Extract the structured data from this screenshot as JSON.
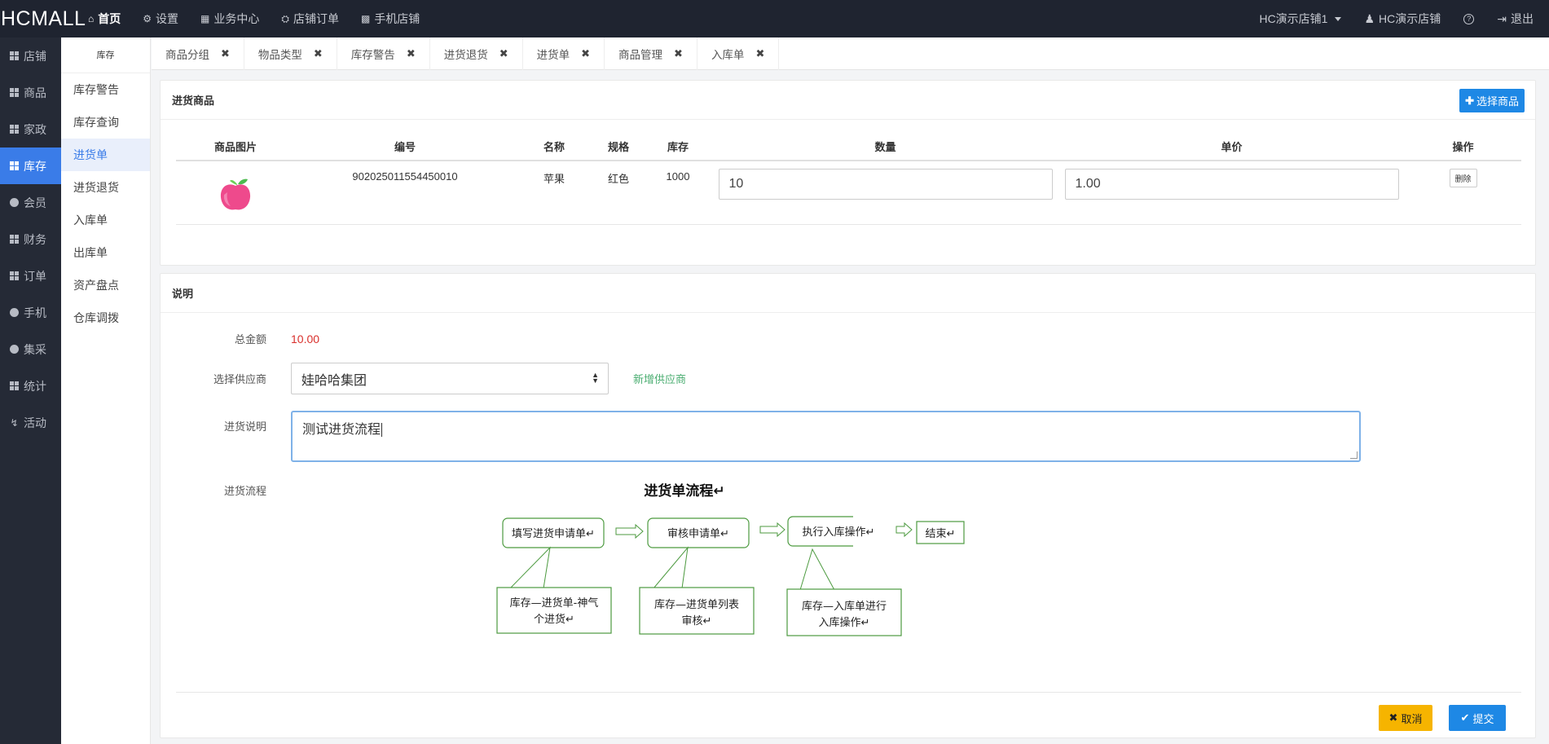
{
  "topbar": {
    "brand": "HCMALL",
    "nav": [
      {
        "label": "首页",
        "icon": "home-icon",
        "active": true
      },
      {
        "label": "设置",
        "icon": "gear-icon"
      },
      {
        "label": "业务中心",
        "icon": "calculator-icon"
      },
      {
        "label": "店铺订单",
        "icon": "cart-icon"
      },
      {
        "label": "手机店铺",
        "icon": "qrcode-icon"
      }
    ],
    "store_select": "HC演示店铺1",
    "user": "HC演示店铺",
    "help_icon": "question-icon",
    "logout": "退出"
  },
  "sidebar": {
    "items": [
      {
        "label": "店铺",
        "icon": "grid-icon"
      },
      {
        "label": "商品",
        "icon": "grid-icon"
      },
      {
        "label": "家政",
        "icon": "grid-icon"
      },
      {
        "label": "库存",
        "icon": "grid-icon",
        "active": true
      },
      {
        "label": "会员",
        "icon": "globe-icon"
      },
      {
        "label": "财务",
        "icon": "grid-icon"
      },
      {
        "label": "订单",
        "icon": "grid-icon"
      },
      {
        "label": "手机",
        "icon": "globe-icon"
      },
      {
        "label": "集采",
        "icon": "globe-icon"
      },
      {
        "label": "统计",
        "icon": "grid-icon"
      },
      {
        "label": "活动",
        "icon": "bolt-icon"
      }
    ]
  },
  "submenu": {
    "title": "库存",
    "items": [
      "库存警告",
      "库存查询",
      "进货单",
      "进货退货",
      "入库单",
      "出库单",
      "资产盘点",
      "仓库调拨"
    ],
    "active_index": 2
  },
  "tabs": [
    "商品分组",
    "物品类型",
    "库存警告",
    "进货退货",
    "进货单",
    "商品管理",
    "入库单"
  ],
  "goods_panel": {
    "title": "进货商品",
    "choose_button": "选择商品",
    "columns": [
      "商品图片",
      "编号",
      "名称",
      "规格",
      "库存",
      "数量",
      "单价",
      "操作"
    ],
    "rows": [
      {
        "code": "902025011554450010",
        "name": "苹果",
        "spec": "红色",
        "stock": "1000",
        "qty": "10",
        "price": "1.00",
        "action": "删除"
      }
    ]
  },
  "desc_panel": {
    "title": "说明",
    "total_label": "总金额",
    "total_value": "10.00",
    "supplier_label": "选择供应商",
    "supplier_value": "娃哈哈集团",
    "new_supplier": "新增供应商",
    "remark_label": "进货说明",
    "remark_value": "测试进货流程",
    "flow_label": "进货流程",
    "flow": {
      "title": "进货单流程↵",
      "steps": [
        "填写进货申请单↵",
        "审核申请单↵",
        "执行入库操作↵",
        "结束↵"
      ],
      "notes": [
        [
          "库存—进货单-神气",
          "个进货↵"
        ],
        [
          "库存—进货单列表",
          "审核↵"
        ],
        [
          "库存—入库单进行",
          "入库操作↵"
        ]
      ]
    },
    "cancel": "取消",
    "submit": "提交"
  },
  "colors": {
    "accent": "#1e88e5",
    "sidebar_active": "#3a7ce8",
    "flow_green": "#4c9a3f",
    "cancel": "#f6b400",
    "amount": "#d9302c"
  }
}
